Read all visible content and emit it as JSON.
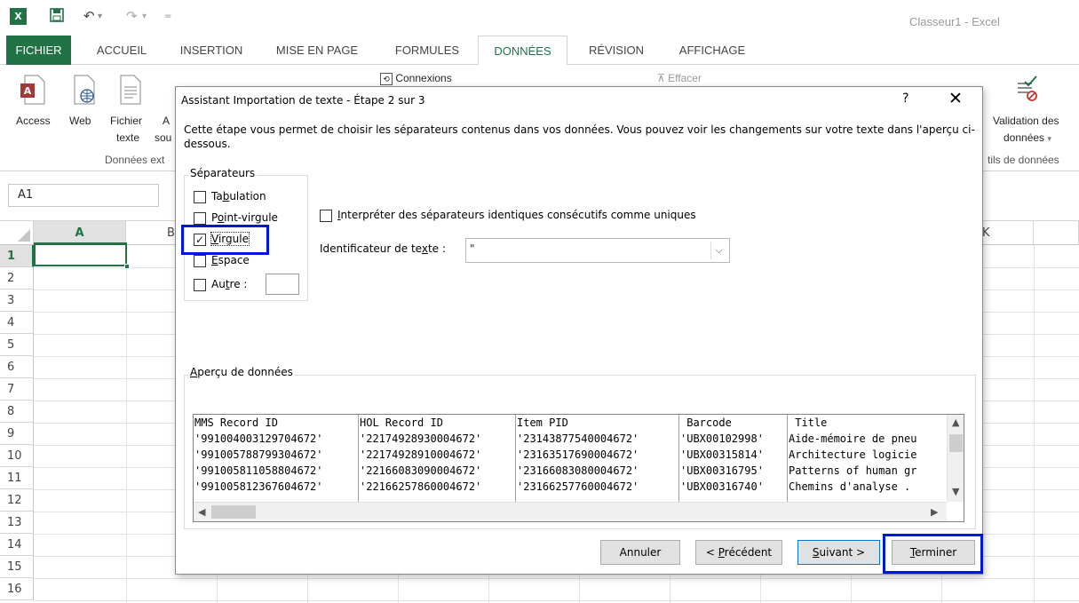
{
  "window": {
    "title": "Classeur1 - Excel"
  },
  "tabs": [
    "FICHIER",
    "ACCUEIL",
    "INSERTION",
    "MISE EN PAGE",
    "FORMULES",
    "DONNÉES",
    "RÉVISION",
    "AFFICHAGE"
  ],
  "ribbon": {
    "access": "Access",
    "web": "Web",
    "fichier_l1": "Fichier",
    "fichier_l2": "texte",
    "autres_l1": "A",
    "autres_l2": "sou",
    "group_external": "Données ext",
    "connexions": "Connexions",
    "effacer": "Effacer",
    "validation_l1": "Validation des",
    "validation_l2": "données",
    "group_tools": "tils de données"
  },
  "namebox": {
    "value": "A1"
  },
  "grid": {
    "columns": [
      "A",
      "B",
      "",
      "",
      "",
      "",
      "",
      "",
      "",
      "",
      "K",
      ""
    ],
    "rows": [
      "1",
      "2",
      "3",
      "4",
      "5",
      "6",
      "7",
      "8",
      "9",
      "10",
      "11",
      "12",
      "13",
      "14",
      "15",
      "16"
    ]
  },
  "dialog": {
    "title": "Assistant Importation de texte - Étape 2 sur 3",
    "help": "?",
    "close": "✕",
    "description": "Cette étape vous permet de choisir les séparateurs contenus dans vos données. Vous pouvez voir les changements sur votre texte dans l'aperçu ci-dessous.",
    "separators_legend": "Séparateurs",
    "separators": {
      "tab": {
        "pre": "Ta",
        "key": "b",
        "post": "ulation",
        "checked": false
      },
      "semicolon": {
        "pre": "P",
        "key": "o",
        "post": "int-virgule",
        "checked": false
      },
      "comma": {
        "pre": "",
        "key": "V",
        "post": "irgule",
        "checked": true
      },
      "space": {
        "pre": "",
        "key": "E",
        "post": "space",
        "checked": false
      },
      "other": {
        "pre": "Au",
        "key": "t",
        "post": "re :",
        "checked": false
      }
    },
    "consecutive": {
      "pre": "",
      "key": "I",
      "post": "nterpréter des séparateurs identiques consécutifs comme uniques",
      "checked": false
    },
    "text_qualifier": {
      "label_pre": "Identificateur de te",
      "label_key": "x",
      "label_post": "te :",
      "value": "\""
    },
    "preview_legend": {
      "key": "A",
      "post": "perçu de données"
    },
    "preview": {
      "columns": [
        {
          "header": "MMS Record ID",
          "cells": [
            "'991004003129704672'",
            "'991005788799304672'",
            "'991005811058804672'",
            "'991005812367604672'"
          ]
        },
        {
          "header": "HOL Record ID",
          "cells": [
            "'22174928930004672'",
            "'22174928910004672'",
            "'22166083090004672'",
            "'22166257860004672'"
          ]
        },
        {
          "header": "Item PID",
          "cells": [
            "'23143877540004672'",
            "'23163517690004672'",
            "'23166083080004672'",
            "'23166257760004672'"
          ]
        },
        {
          "header": " Barcode",
          "cells": [
            "'UBX00102998'",
            "'UBX00315814'",
            "'UBX00316795'",
            "'UBX00316740'"
          ]
        },
        {
          "header": " Title",
          "cells": [
            "Aide-mémoire de pneu",
            "Architecture logicie",
            "Patterns of human gr",
            "Chemins d'analyse ."
          ]
        }
      ]
    },
    "buttons": {
      "cancel": "Annuler",
      "previous": {
        "pre": "< ",
        "key": "P",
        "post": "récédent"
      },
      "next": {
        "pre": "",
        "key": "S",
        "post": "uivant >"
      },
      "finish": {
        "pre": "",
        "key": "T",
        "post": "erminer"
      }
    }
  }
}
